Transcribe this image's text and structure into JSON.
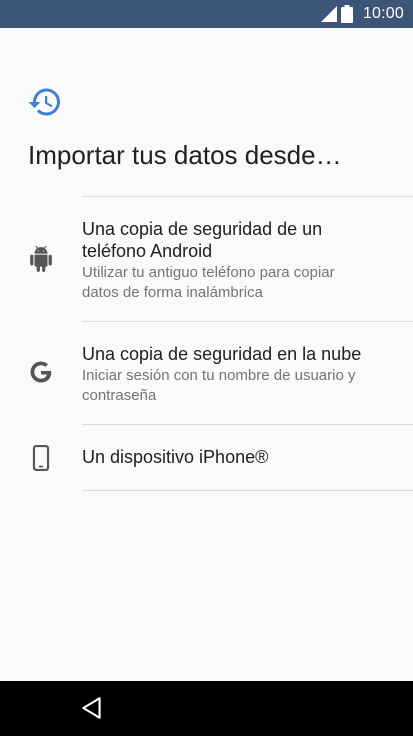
{
  "status_bar": {
    "time": "10:00",
    "icons": [
      "signal-icon",
      "battery-icon"
    ],
    "background": "#3d5577"
  },
  "header": {
    "icon": "restore-history-icon",
    "icon_color": "#3f7fd6",
    "title": "Importar tus datos desde…"
  },
  "options": [
    {
      "icon": "android-icon",
      "title_line1": "Una copia de seguridad de un",
      "title_line2": "teléfono Android",
      "subtitle_line1": "Utilizar tu antiguo teléfono para copiar",
      "subtitle_line2": "datos de forma inalámbrica"
    },
    {
      "icon": "google-g-icon",
      "title_line1": "Una copia de seguridad en la nube",
      "subtitle_line1": "Iniciar sesión con tu nombre de usuario y",
      "subtitle_line2": "contraseña"
    },
    {
      "icon": "smartphone-icon",
      "title_line1": "Un dispositivo iPhone®"
    }
  ],
  "nav_bar": {
    "icons": [
      "back-icon"
    ]
  }
}
